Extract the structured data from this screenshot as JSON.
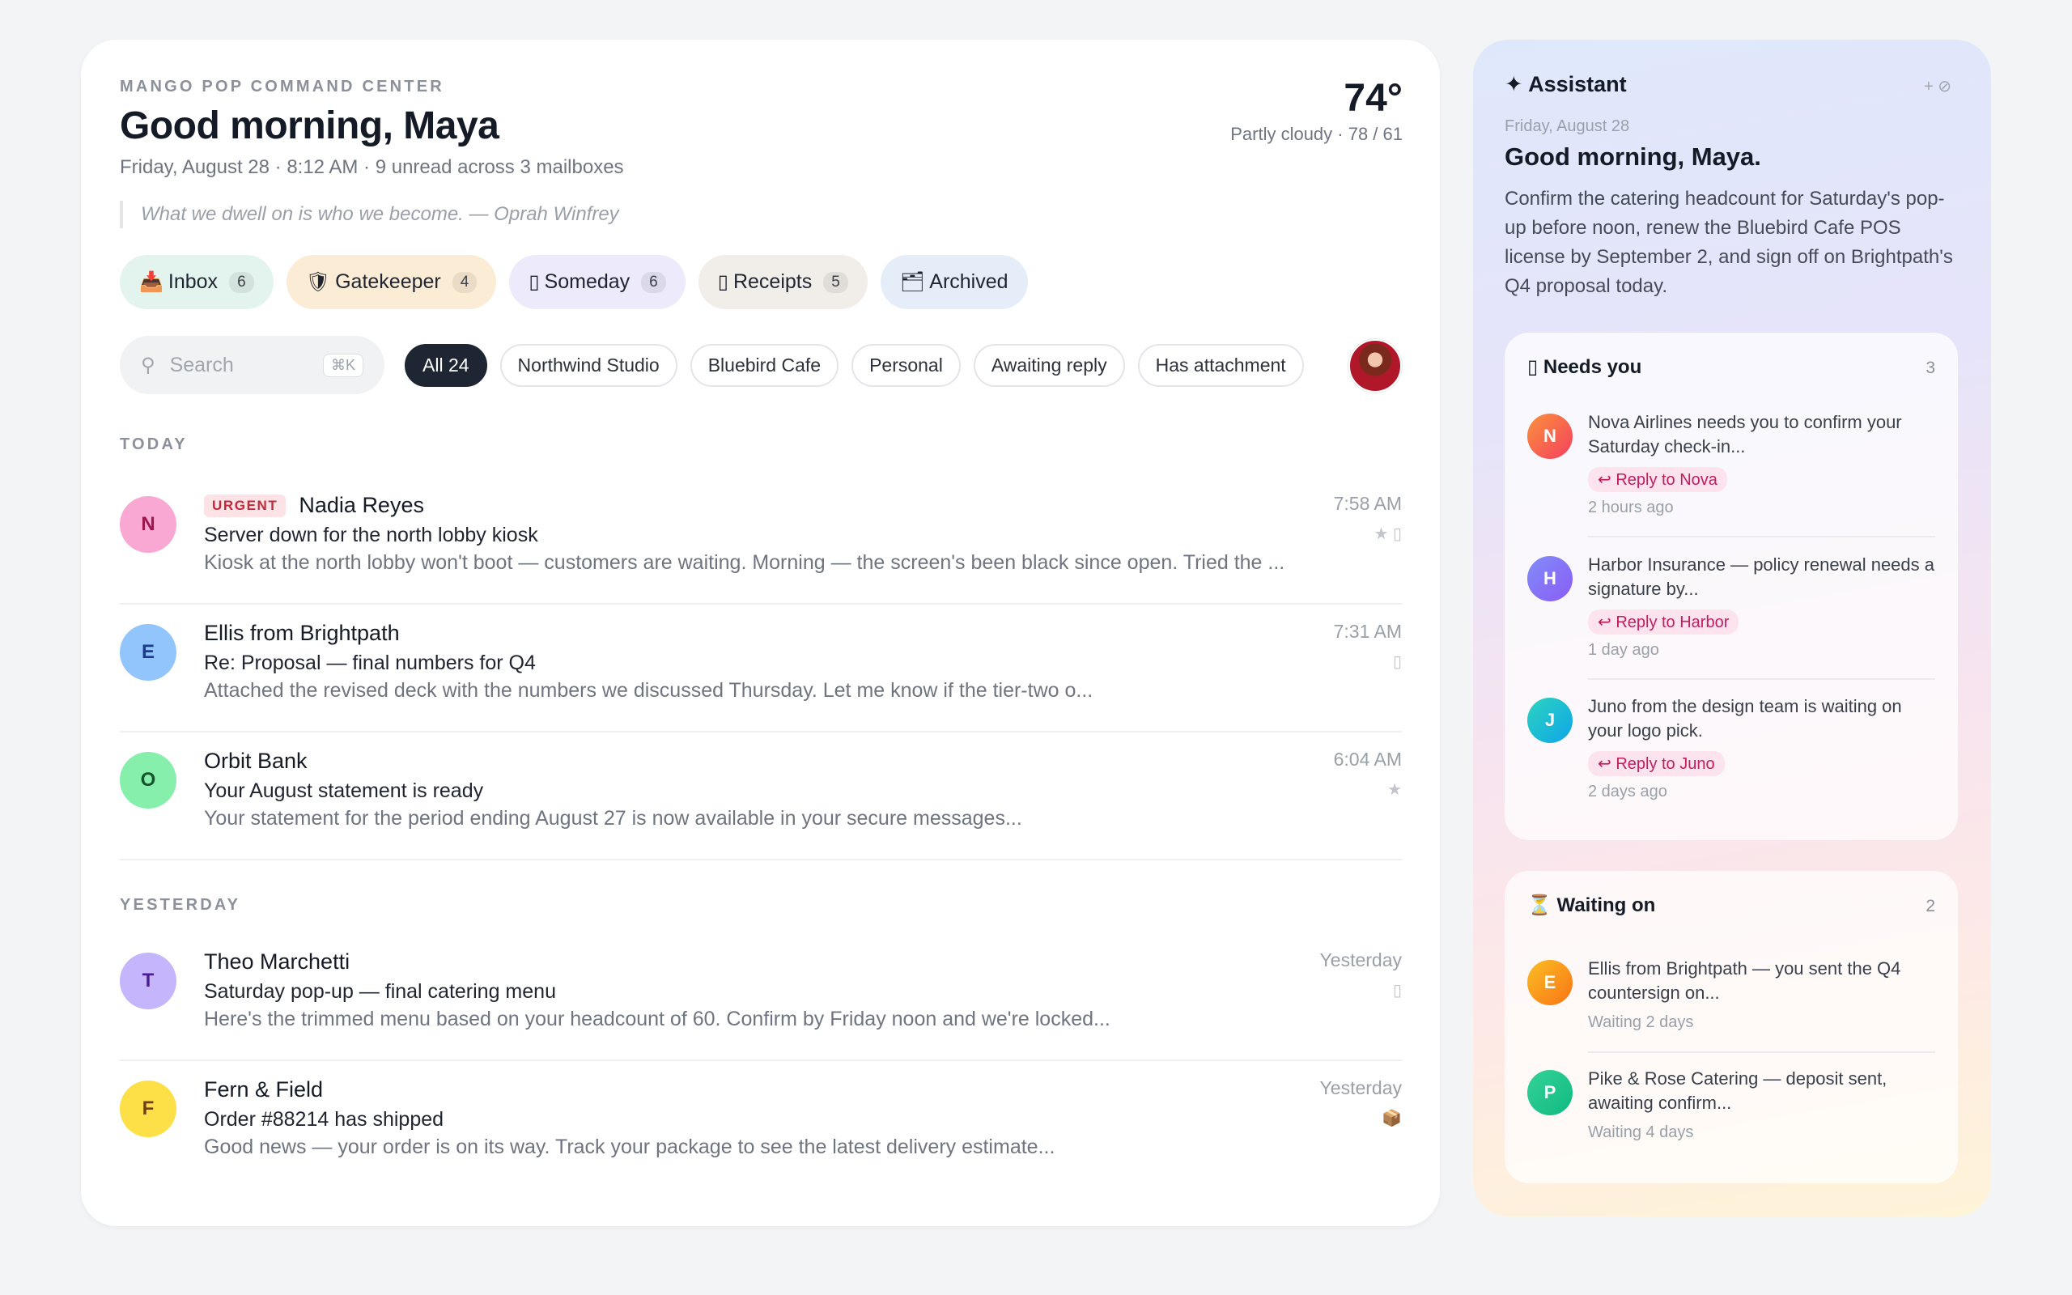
{
  "header": {
    "brand": "MANGO POP COMMAND CENTER",
    "greeting": "Good morning, Maya",
    "date_line": "Friday, August 28 · 8:12 AM · 9 unread across 3 mailboxes",
    "quote": "What we dwell on is who we become. — Oprah Winfrey"
  },
  "weather": {
    "temp": "74°",
    "desc": "Partly cloudy · 78 / 61"
  },
  "mailboxes": [
    {
      "icon": "📥",
      "label": "Inbox",
      "count": "6"
    },
    {
      "icon": "🛡",
      "label": "Gatekeeper",
      "count": "4"
    },
    {
      "icon": "▯",
      "label": "Someday",
      "count": "6"
    },
    {
      "icon": "▯",
      "label": "Receipts",
      "count": "5"
    },
    {
      "icon": "🗂",
      "label": "Archived",
      "count": ""
    }
  ],
  "search": {
    "placeholder": "Search",
    "shortcut": "⌘K"
  },
  "filters": [
    "All 24",
    "Northwind Studio",
    "Bluebird Cafe",
    "Personal",
    "Awaiting reply",
    "Has attachment"
  ],
  "sections": {
    "today": "TODAY",
    "yesterday": "YESTERDAY"
  },
  "emails_today": [
    {
      "initial": "N",
      "badge": "URGENT",
      "sender": "Nadia Reyes",
      "subject": "Server down for the north lobby kiosk",
      "preview": "Kiosk at the north lobby won't boot — customers are waiting. Morning — the screen's been black since open. Tried the ...",
      "time": "7:58 AM",
      "flags": "★ ▯"
    },
    {
      "initial": "E",
      "badge": "",
      "sender": "Ellis from Brightpath",
      "subject": "Re: Proposal — final numbers for Q4",
      "preview": "Attached the revised deck with the numbers we discussed Thursday. Let me know if the tier-two o...",
      "time": "7:31 AM",
      "flags": "▯"
    },
    {
      "initial": "O",
      "badge": "",
      "sender": "Orbit Bank",
      "subject": "Your August statement is ready",
      "preview": "Your statement for the period ending August 27 is now available in your secure messages...",
      "time": "6:04 AM",
      "flags": "★"
    }
  ],
  "emails_yesterday": [
    {
      "initial": "T",
      "badge": "",
      "sender": "Theo Marchetti",
      "subject": "Saturday pop-up — final catering menu",
      "preview": "Here's the trimmed menu based on your headcount of 60. Confirm by Friday noon and we're locked...",
      "time": "Yesterday",
      "flags": "▯"
    },
    {
      "initial": "F",
      "badge": "",
      "sender": "Fern & Field",
      "subject": "Order #88214 has shipped",
      "preview": "Good news — your order is on its way. Track your package to see the latest delivery estimate...",
      "time": "Yesterday",
      "flags": "📦"
    }
  ],
  "assistant": {
    "title": "✦ Assistant",
    "tools": "+ ⊘",
    "date": "Friday, August 28",
    "greeting": "Good morning, Maya.",
    "summary": "Confirm the catering headcount for Saturday's pop-up before noon, renew the Bluebird Cafe POS license by September 2, and sign off on Brightpath's Q4 proposal today.",
    "needs_you": {
      "title": "▯ Needs you",
      "count": "3",
      "items": [
        {
          "initial": "N",
          "text": "Nova Airlines needs you to confirm your Saturday check-in...",
          "reply": "↩ Reply to Nova",
          "meta": "2 hours ago"
        },
        {
          "initial": "H",
          "text": "Harbor Insurance — policy renewal needs a signature by...",
          "reply": "↩ Reply to Harbor",
          "meta": "1 day ago"
        },
        {
          "initial": "J",
          "text": "Juno from the design team is waiting on your logo pick.",
          "reply": "↩ Reply to Juno",
          "meta": "2 days ago"
        }
      ]
    },
    "waiting_on": {
      "title": "⏳ Waiting on",
      "count": "2",
      "items": [
        {
          "initial": "E",
          "text": "Ellis from Brightpath — you sent the Q4 countersign on...",
          "meta": "Waiting 2 days"
        },
        {
          "initial": "P",
          "text": "Pike & Rose Catering — deposit sent, awaiting confirm...",
          "meta": "Waiting 4 days"
        }
      ]
    }
  },
  "colors": {
    "accent_dark": "#1e2633",
    "urgent": "#c02a3a",
    "reply_pink": "#c21d5f"
  }
}
